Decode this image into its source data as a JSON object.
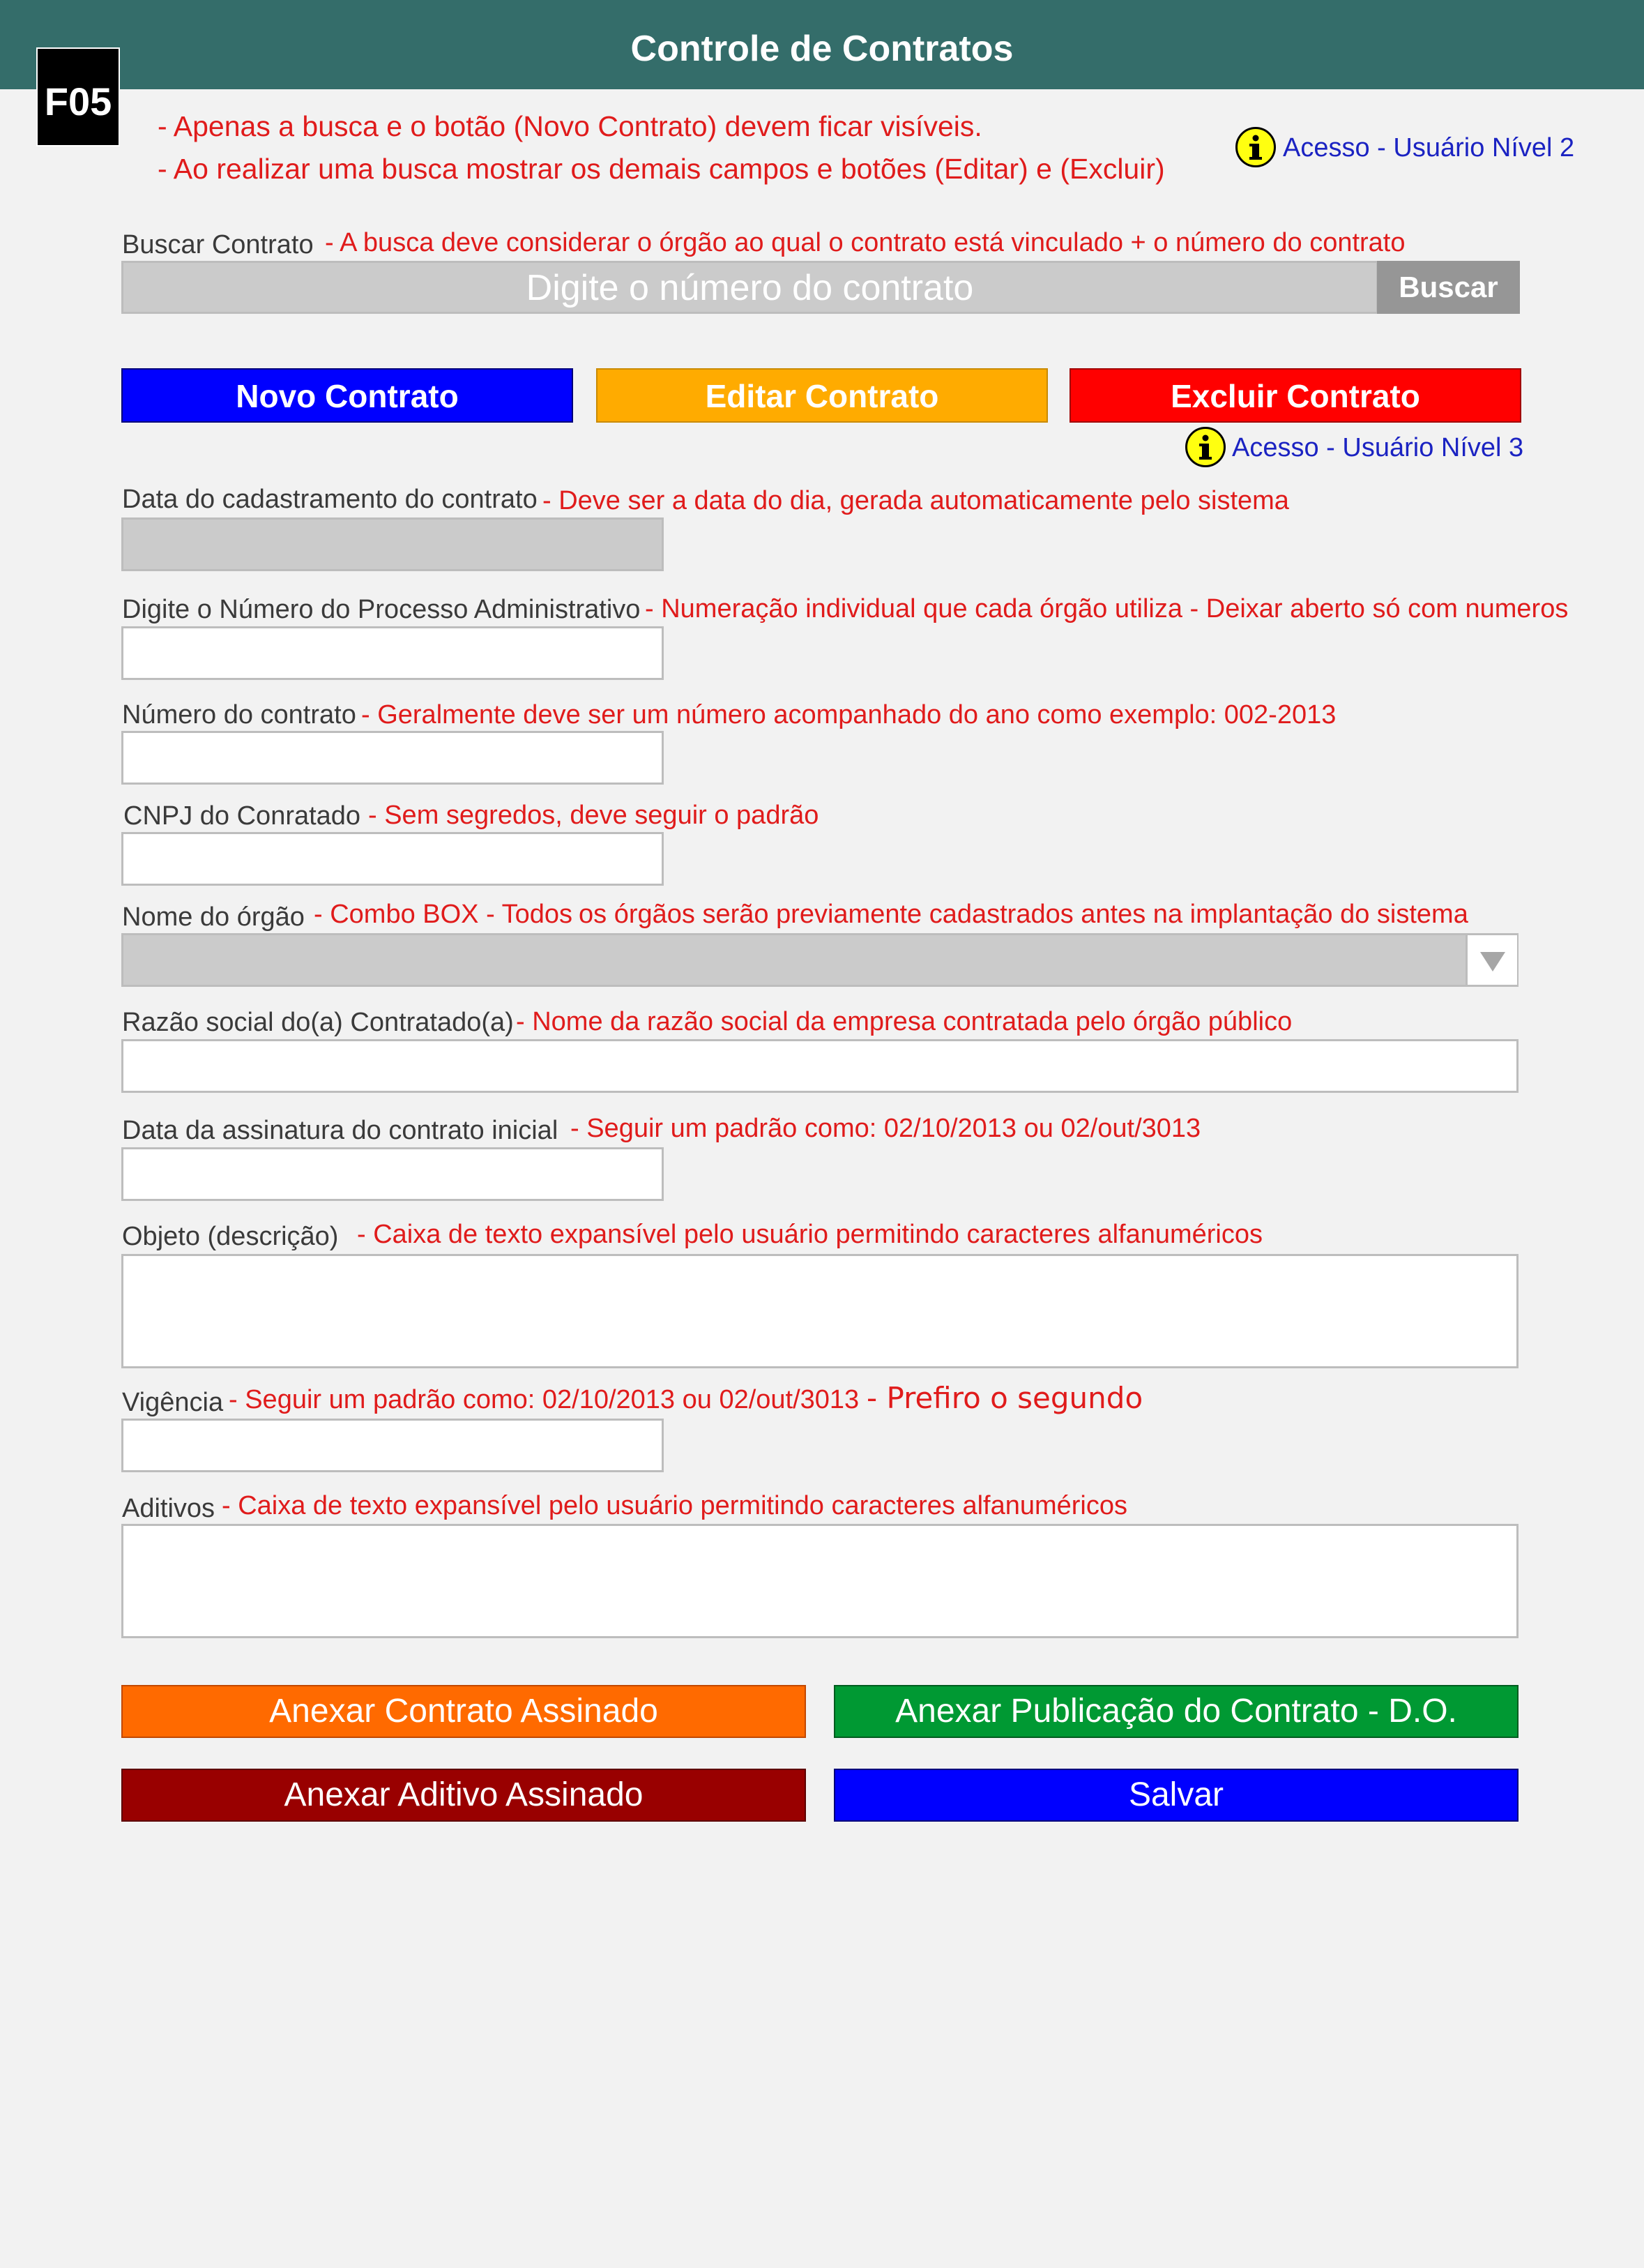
{
  "header": {
    "title": "Controle de Contratos",
    "badge": "F05"
  },
  "notes": {
    "line1": "- Apenas a busca e o botão (Novo Contrato) devem ficar visíveis.",
    "line2": "- Ao realizar uma busca mostrar os demais campos e botões (Editar) e (Excluir)",
    "access_level2": "Acesso - Usuário Nível 2",
    "access_level3": "Acesso - Usuário Nível 3"
  },
  "search": {
    "label": "Buscar Contrato",
    "note": "- A busca deve considerar o órgão ao qual o contrato está vinculado + o número do contrato",
    "placeholder": "Digite o número do contrato",
    "button": "Buscar"
  },
  "actions": {
    "new": "Novo Contrato",
    "edit": "Editar Contrato",
    "delete": "Excluir Contrato"
  },
  "fields": {
    "registration_date": {
      "label": "Data do cadastramento do contrato",
      "note": "- Deve ser a data do dia, gerada automaticamente pelo sistema"
    },
    "process_number": {
      "label": "Digite o Número do Processo Administrativo",
      "note": "- Numeração individual que cada órgão utiliza - Deixar aberto só com numeros"
    },
    "contract_number": {
      "label": "Número do contrato",
      "note": "- Geralmente deve ser um número acompanhado do ano como exemplo: 002-2013"
    },
    "cnpj": {
      "label": "CNPJ do Conratado",
      "note": "- Sem segredos, deve seguir o padrão"
    },
    "organ": {
      "label": "Nome do órgão",
      "note_a": "- Combo BOX - Todos",
      "note_b": "os órgãos serão previamente cadastrados antes na implantação do sistema"
    },
    "company_name": {
      "label": "Razão social do(a) Contratado(a)",
      "note": "- Nome da razão social da empresa contratada pelo órgão público"
    },
    "signature_date": {
      "label": "Data da assinatura do contrato inicial",
      "note": "- Seguir um padrão como:  02/10/2013 ou 02/out/3013"
    },
    "object": {
      "label": "Objeto (descrição)",
      "note": "- Caixa de texto expansível pelo usuário permitindo caracteres alfanuméricos"
    },
    "validity": {
      "label": "Vigência",
      "note": "- Seguir um padrão como:  02/10/2013 ou 02/out/3013",
      "note_extra": "- Prefiro o segundo"
    },
    "amendments": {
      "label": "Aditivos",
      "note": "- Caixa de texto expansível pelo usuário permitindo caracteres alfanuméricos"
    }
  },
  "bottom_buttons": {
    "attach_contract": "Anexar Contrato Assinado",
    "attach_publication": "Anexar Publicação do Contrato - D.O.",
    "attach_amendment": "Anexar Aditivo Assinado",
    "save": "Salvar"
  },
  "colors": {
    "header": "#346d6a",
    "note_red": "#e01b1b",
    "access_blue": "#1b23c2",
    "new_button": "#0000ff",
    "edit_button": "#ffab00",
    "delete_button": "#ff0000",
    "attach_contract_button": "#ff6a00",
    "attach_publication_button": "#009933",
    "attach_amendment_button": "#990000",
    "save_button": "#0000ff"
  },
  "icons": {
    "info": "info-icon",
    "dropdown": "triangle-down-icon"
  }
}
